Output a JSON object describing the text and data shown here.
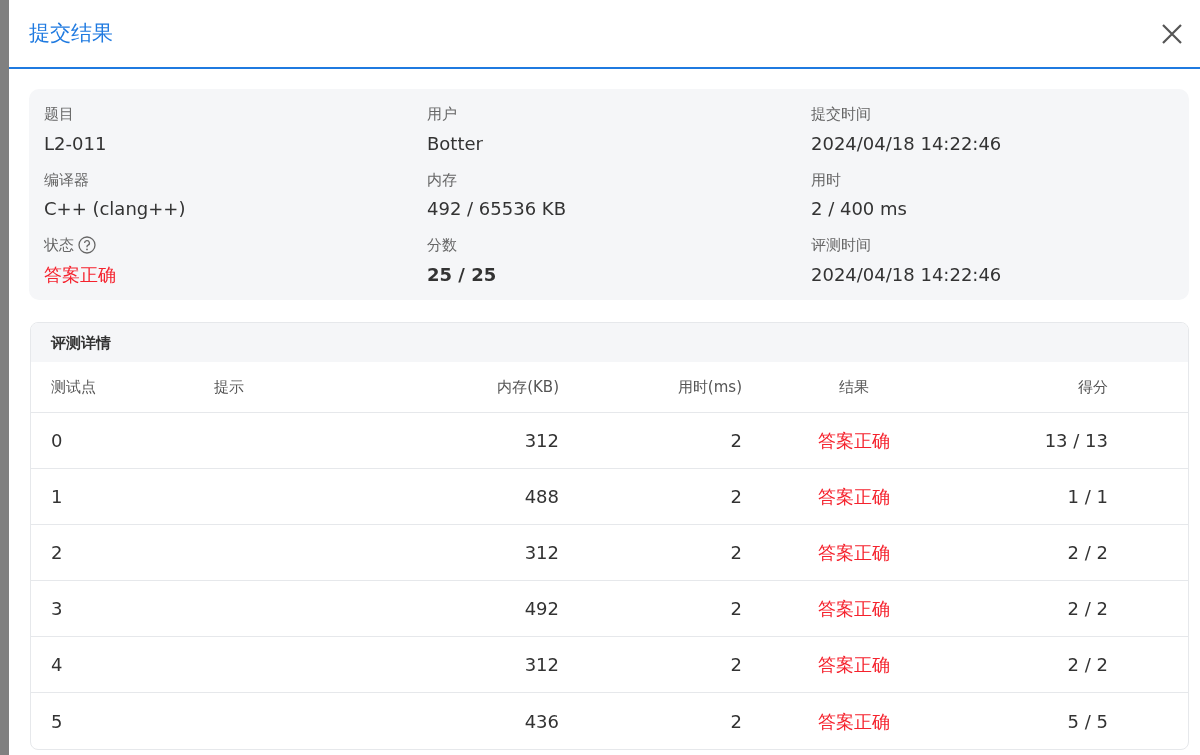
{
  "dialog": {
    "title": "提交结果"
  },
  "summary": [
    {
      "label": "题目",
      "value": "L2-011"
    },
    {
      "label": "用户",
      "value": "Botter"
    },
    {
      "label": "提交时间",
      "value": "2024/04/18 14:22:46"
    },
    {
      "label": "编译器",
      "value": "C++ (clang++)"
    },
    {
      "label": "内存",
      "value": "492 / 65536 KB"
    },
    {
      "label": "用时",
      "value": "2 / 400 ms"
    },
    {
      "label": "状态",
      "value": "答案正确",
      "kind": "status"
    },
    {
      "label": "分数",
      "value": "25 / 25",
      "kind": "score"
    },
    {
      "label": "评测时间",
      "value": "2024/04/18 14:22:46"
    }
  ],
  "details": {
    "title": "评测详情",
    "columns": [
      "测试点",
      "提示",
      "内存(KB)",
      "用时(ms)",
      "结果",
      "得分"
    ],
    "rows": [
      [
        "0",
        "",
        "312",
        "2",
        "答案正确",
        "13 / 13"
      ],
      [
        "1",
        "",
        "488",
        "2",
        "答案正确",
        "1 / 1"
      ],
      [
        "2",
        "",
        "312",
        "2",
        "答案正确",
        "2 / 2"
      ],
      [
        "3",
        "",
        "492",
        "2",
        "答案正确",
        "2 / 2"
      ],
      [
        "4",
        "",
        "312",
        "2",
        "答案正确",
        "2 / 2"
      ],
      [
        "5",
        "",
        "436",
        "2",
        "答案正确",
        "5 / 5"
      ]
    ]
  }
}
